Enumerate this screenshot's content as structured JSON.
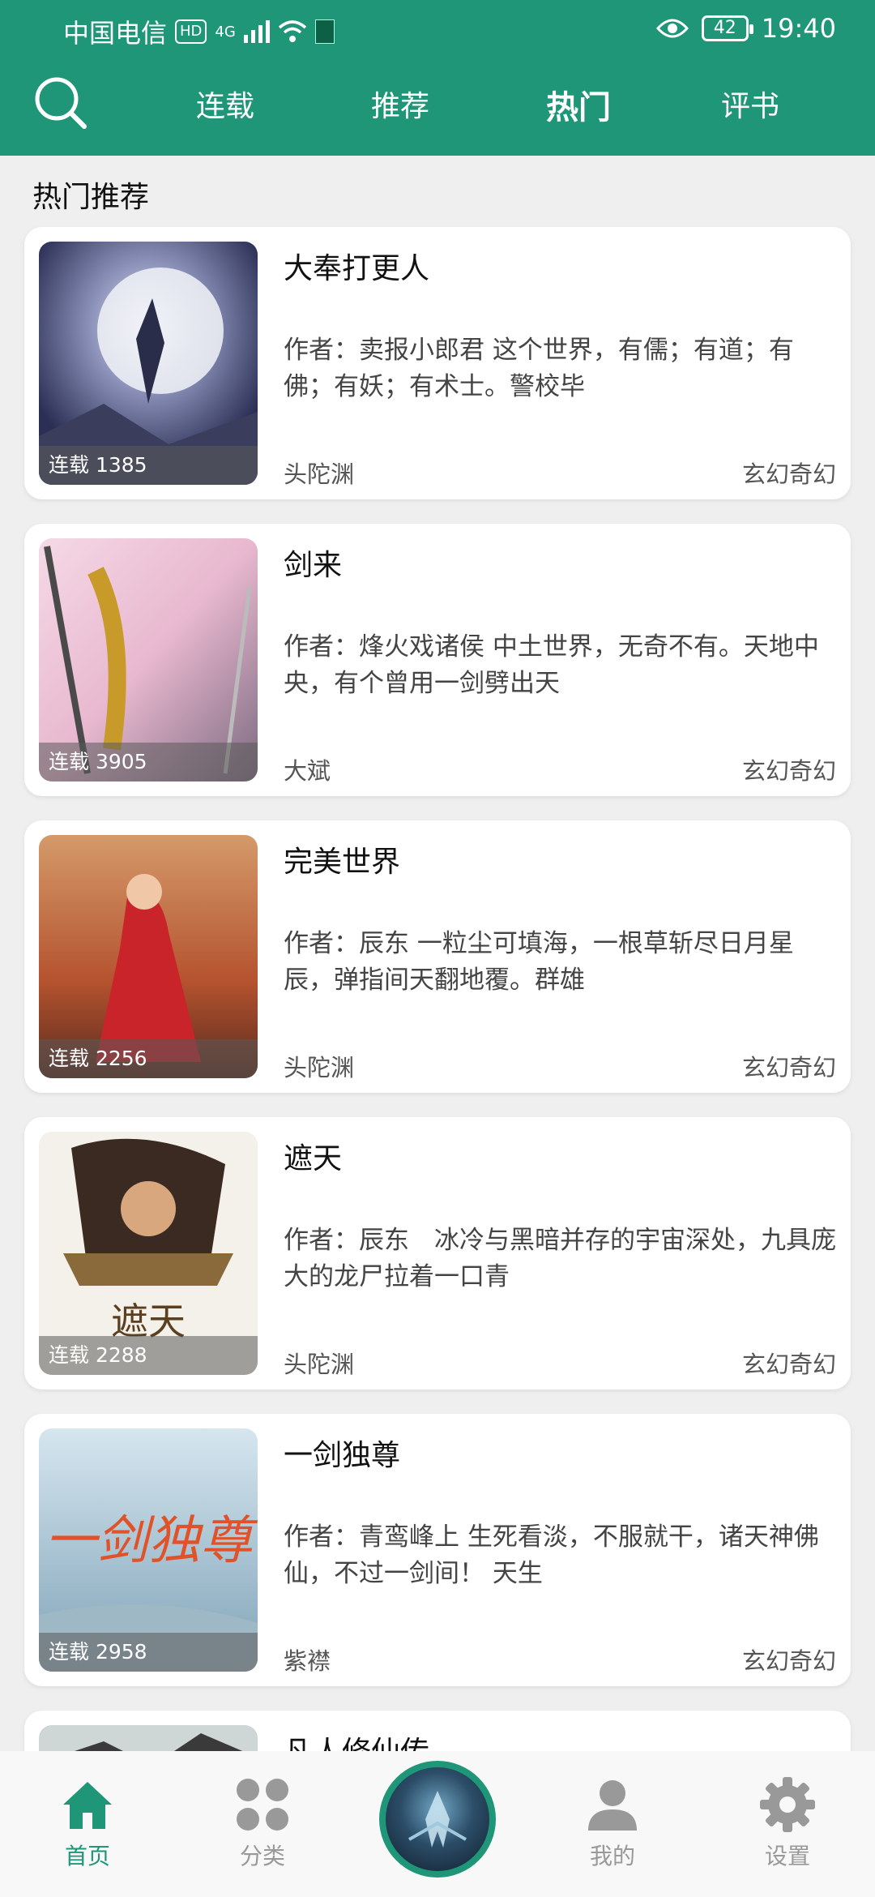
{
  "status_bar": {
    "carrier": "中国电信",
    "hd": "HD",
    "network": "4G",
    "battery": "42",
    "time": "19:40"
  },
  "top_tabs": [
    {
      "label": "连载"
    },
    {
      "label": "推荐"
    },
    {
      "label": "热门"
    },
    {
      "label": "评书"
    }
  ],
  "section_title": "热门推荐",
  "books": [
    {
      "title": "大奉打更人",
      "desc": "作者：卖报小郎君 这个世界，有儒；有道；有佛；有妖；有术士。警校毕",
      "status": "连载 1385",
      "source": "头陀渊",
      "genre": "玄幻奇幻"
    },
    {
      "title": "剑来",
      "desc": "作者：烽火戏诸侯 中土世界，无奇不有。天地中央，有个曾用一剑劈出天",
      "status": "连载 3905",
      "source": "大斌",
      "genre": "玄幻奇幻"
    },
    {
      "title": "完美世界",
      "desc": "作者：辰东 一粒尘可填海，一根草斩尽日月星辰，弹指间天翻地覆。群雄",
      "status": "连载 2256",
      "source": "头陀渊",
      "genre": "玄幻奇幻"
    },
    {
      "title": "遮天",
      "desc": "作者：辰东　冰冷与黑暗并存的宇宙深处，九具庞大的龙尸拉着一口青",
      "status": "连载 2288",
      "source": "头陀渊",
      "genre": "玄幻奇幻"
    },
    {
      "title": "一剑独尊",
      "desc": "作者：青鸾峰上 生死看淡，不服就干，诸天神佛仙，不过一剑间！ 天生",
      "status": "连载 2958",
      "source": "紫襟",
      "genre": "玄幻奇幻"
    },
    {
      "title": "凡人修仙传",
      "desc": "",
      "status": "",
      "source": "",
      "genre": ""
    }
  ],
  "bottom_nav": [
    {
      "label": "首页"
    },
    {
      "label": "分类"
    },
    {
      "label": "我的"
    },
    {
      "label": "设置"
    }
  ],
  "colors": {
    "primary": "#1e9677",
    "background": "#efefef",
    "inactive": "#999999"
  }
}
